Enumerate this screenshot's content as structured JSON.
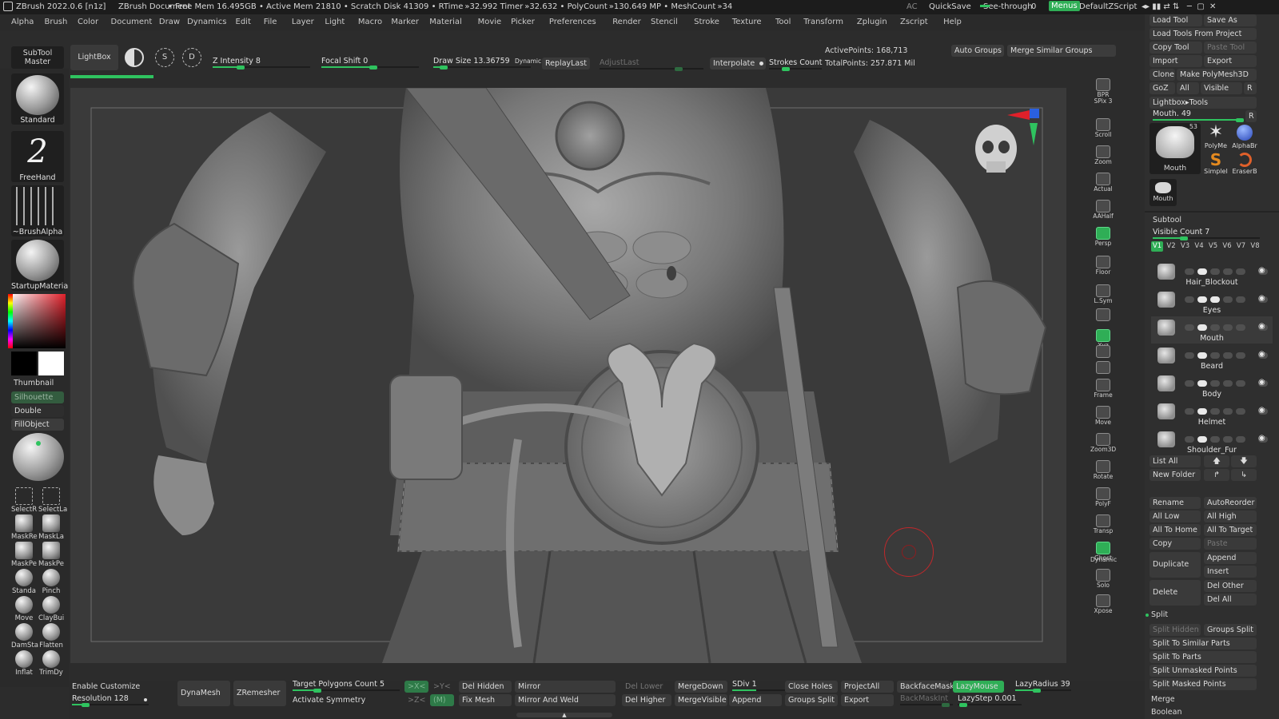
{
  "app": {
    "title": "ZBrush 2022.0.6 [n1z]",
    "document": "ZBrush Document",
    "stats": "• Free Mem 16.495GB • Active Mem 21810 • Scratch Disk 41309 • RTime »32.992 Timer »32.632 • PolyCount »130.649 MP • MeshCount »34",
    "ac": "AC",
    "quicksave": "QuickSave",
    "see_through": "See-through",
    "see_through_value": "0",
    "menus": "Menus",
    "default_zscript": "DefaultZScript"
  },
  "menu": [
    "Alpha",
    "Brush",
    "Color",
    "Document",
    "Draw",
    "Dynamics",
    "Edit",
    "File",
    "Layer",
    "Light",
    "Macro",
    "Marker",
    "Material",
    "Movie",
    "Picker",
    "Preferences",
    "Render",
    "Stencil",
    "Stroke",
    "Texture",
    "Tool",
    "Transform",
    "Zplugin",
    "Zscript",
    "Help"
  ],
  "top": {
    "subtool_master_1": "SubTool",
    "subtool_master_2": "Master",
    "lightbox": "LightBox",
    "z_intensity": "Z Intensity 8",
    "focal_shift": "Focal Shift 0",
    "draw_size": "Draw Size 13.36759",
    "dynamic": "Dynamic",
    "replay_last": "ReplayLast",
    "adjust_last": "AdjustLast",
    "interpolate": "Interpolate",
    "strokes_count": "Strokes Count",
    "active_points": "ActivePoints: 168,713",
    "total_points": "TotalPoints: 257.871 Mil",
    "auto_groups": "Auto Groups",
    "merge_similar_groups": "Merge Similar Groups"
  },
  "left": {
    "standard": "Standard",
    "freehand": "FreeHand",
    "brush_alpha": "~BrushAlpha",
    "startup_material": "StartupMateria",
    "thumbnail": "Thumbnail",
    "silhouette": "Silhouette",
    "double": "Double",
    "fill_object": "FillObject",
    "tools": [
      "SelectR",
      "SelectLa",
      "MaskRe",
      "MaskLa",
      "MaskPe",
      "MaskPe",
      "Standa",
      "Pinch",
      "Move",
      "ClayBui",
      "DamSta",
      "Flatten",
      "Inflat",
      "TrimDy"
    ]
  },
  "right_shelf": [
    "BPR",
    "SPix 3",
    "Scroll",
    "Zoom",
    "Actual",
    "AAHalf",
    "Persp",
    "Floor",
    "L.Sym",
    "",
    "Xyz",
    "",
    "",
    "Frame",
    "Move",
    "Zoom3D",
    "Rotate",
    "PolyF",
    "Transp",
    "Ghost",
    "Dynamic",
    "Solo",
    "Xpose"
  ],
  "right_panel": {
    "load_tool": "Load Tool",
    "save_as": "Save As",
    "load_tools_from_project": "Load Tools From Project",
    "copy_tool": "Copy Tool",
    "paste_tool": "Paste Tool",
    "import": "Import",
    "export": "Export",
    "clone": "Clone",
    "make_polymesh": "Make PolyMesh3D",
    "goz": "GoZ",
    "all": "All",
    "visible": "Visible",
    "r": "R",
    "lightbox_tools": "Lightbox▸Tools",
    "mouth_slider": "Mouth. 49",
    "tool_thumbs": [
      "Mouth",
      "PolyMe",
      "AlphaBr",
      "SimpleI",
      "EraserB",
      "Mouth"
    ],
    "tool_count": "53",
    "subtool": "Subtool",
    "visible_count": "Visible Count 7",
    "versions": [
      "V1",
      "V2",
      "V3",
      "V4",
      "V5",
      "V6",
      "V7",
      "V8"
    ],
    "subtools": [
      "Hair_Blockout",
      "Eyes",
      "Mouth",
      "Beard",
      "Body",
      "Helmet",
      "Shoulder_Fur"
    ],
    "list_all": "List All",
    "new_folder": "New Folder",
    "rename": "Rename",
    "auto_reorder": "AutoReorder",
    "all_low": "All Low",
    "all_high": "All High",
    "all_to_home": "All To Home",
    "all_to_target": "All To Target",
    "copy": "Copy",
    "paste": "Paste",
    "duplicate": "Duplicate",
    "append": "Append",
    "insert": "Insert",
    "delete": "Delete",
    "del_other": "Del Other",
    "del_all": "Del All",
    "split": "Split",
    "split_hidden": "Split Hidden",
    "groups_split": "Groups Split",
    "split_to_similar_parts": "Split To Similar Parts",
    "split_to_parts": "Split To Parts",
    "split_unmasked_points": "Split Unmasked Points",
    "split_masked_points": "Split Masked Points",
    "merge": "Merge",
    "boolean": "Boolean"
  },
  "bottom": {
    "enable_customize": "Enable Customize",
    "resolution": "Resolution 128",
    "dynamesh": "DynaMesh",
    "zremesher": "ZRemesher",
    "target_polygons": "Target Polygons Count 5",
    "activate_symmetry": "Activate Symmetry",
    "x_sym": ">X<",
    "y_sym": ">Y<",
    "z_sym": ">Z<",
    "m_sym": "(M)",
    "del_hidden": "Del Hidden",
    "fix_mesh": "Fix Mesh",
    "mirror": "Mirror",
    "mirror_and_weld": "Mirror And Weld",
    "del_lower": "Del Lower",
    "del_higher": "Del Higher",
    "merge_down": "MergeDown",
    "merge_visible": "MergeVisible",
    "sdiv": "SDiv 1",
    "append": "Append",
    "close_holes": "Close Holes",
    "groups_split": "Groups Split",
    "project_all": "ProjectAll",
    "export": "Export",
    "backface_mask": "BackfaceMask",
    "back_mask_int": "BackMaskInt",
    "lazy_mouse": "LazyMouse",
    "lazy_radius": "LazyRadius 39",
    "lazy_step": "LazyStep 0.001"
  },
  "colors": {
    "accent": "#2fae56",
    "background": "#2c2c2c",
    "viewport": "#3a3a3a",
    "brush_cursor": "#c0282b"
  }
}
